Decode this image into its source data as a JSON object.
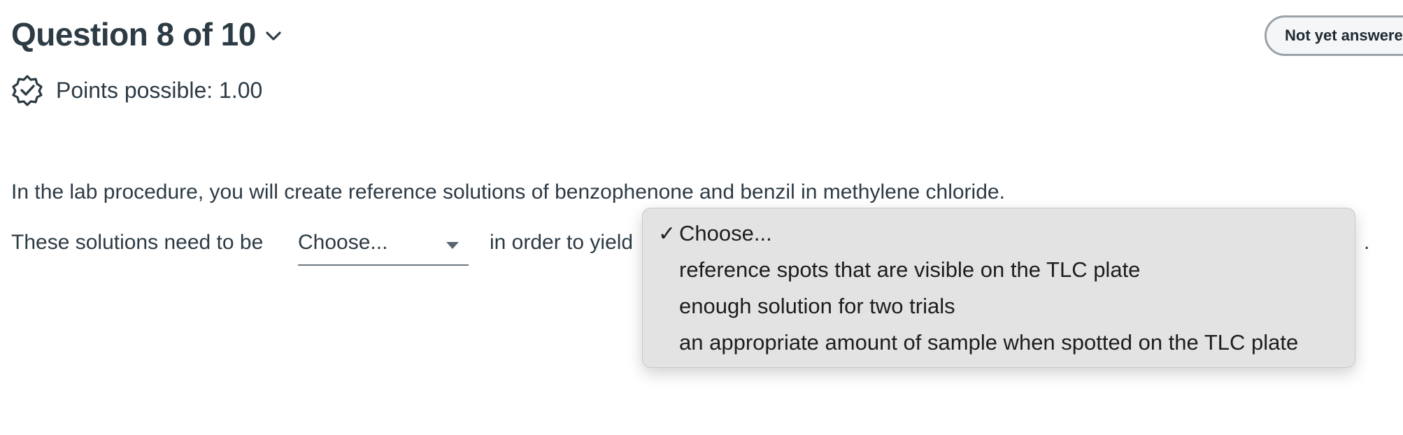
{
  "question": {
    "title": "Question 8 of 10",
    "status": "Not yet answered"
  },
  "points": {
    "label": "Points possible: 1.00"
  },
  "prompt": {
    "intro": "In the lab procedure, you will create reference solutions of benzophenone and benzil in methylene chloride.",
    "sentence_prefix": "These solutions need to be",
    "sentence_middle": "in order to yield",
    "sentence_end": "."
  },
  "select": {
    "selected": "Choose..."
  },
  "dropdown": {
    "checkmark": "✓",
    "options": [
      {
        "label": "Choose...",
        "checked": true
      },
      {
        "label": "reference spots that are visible on the TLC plate",
        "checked": false
      },
      {
        "label": "enough solution for two trials",
        "checked": false
      },
      {
        "label": "an appropriate amount of sample when spotted on the TLC plate",
        "checked": false
      }
    ]
  },
  "icons": {
    "chevron": "chevron-down-icon",
    "points": "badge-check-icon"
  },
  "colors": {
    "text": "#2d3b45",
    "badge_border": "#9aa3a9",
    "menu_bg": "#e3e3e3"
  }
}
